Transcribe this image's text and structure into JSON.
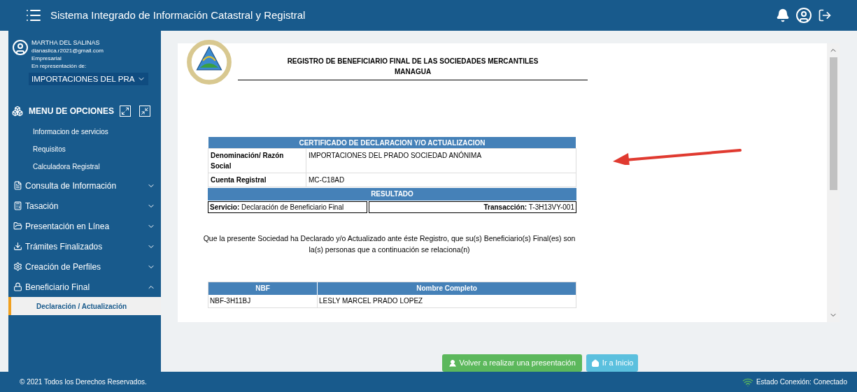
{
  "header": {
    "title": "Sistema Integrado de Información Catastral y Registral"
  },
  "user": {
    "name": "MARTHA DEL SALINAS",
    "email": "dianasiica.r2021@gmail.com",
    "role": "Empresarial",
    "representation_label": "En representación de:",
    "representation": "IMPORTACIONES DEL PRA"
  },
  "menu": {
    "title": "MENU DE OPCIONES",
    "links": [
      "Informacion de servicios",
      "Requisitos",
      "Calculadora Registral"
    ],
    "sections": [
      {
        "label": "Consulta de Información",
        "expanded": false
      },
      {
        "label": "Tasación",
        "expanded": false
      },
      {
        "label": "Presentación en Línea",
        "expanded": false
      },
      {
        "label": "Trámites Finalizados",
        "expanded": false
      },
      {
        "label": "Creación de Perfiles",
        "expanded": false
      },
      {
        "label": "Beneficiario Final",
        "expanded": true,
        "children": [
          {
            "label": "Declaración / Actualización",
            "selected": true
          }
        ]
      }
    ]
  },
  "document": {
    "title": "REGISTRO DE BENEFICIARIO FINAL DE LAS SOCIEDADES MERCANTILES",
    "subtitle": "MANAGUA",
    "certificate": {
      "heading": "CERTIFICADO DE DECLARACION Y/O ACTUALIZACION",
      "rows": [
        {
          "label": "Denominación/ Razón Social",
          "value": "IMPORTACIONES DEL PRADO SOCIEDAD ANÓNIMA"
        },
        {
          "label": "Cuenta Registral",
          "value": "MC-C18AD"
        }
      ],
      "result_heading": "RESULTADO",
      "service_label": "Servicio:",
      "service": "Declaración de Beneficiario Final",
      "transaction_label": "Transacción:",
      "transaction": "T-3H13VY-001"
    },
    "statement": "Que la presente Sociedad ha Declarado y/o Actualizado ante éste Registro, que su(s) Beneficiario(s) Final(es) son la(s) personas que a continuación se relaciona(n)",
    "beneficiaries": {
      "columns": [
        "NBF",
        "Nombre Completo"
      ],
      "rows": [
        [
          "NBF-3H11BJ",
          "LESLY MARCEL PRADO LOPEZ"
        ]
      ]
    }
  },
  "buttons": [
    {
      "label": "Volver a realizar una presentación",
      "kind": "primary"
    },
    {
      "label": "Ir a Inicio",
      "kind": "home"
    }
  ],
  "footer": {
    "copyright": "© 2021 Todos los Derechos Reservados.",
    "status": "Estado Conexión: Conectado"
  }
}
